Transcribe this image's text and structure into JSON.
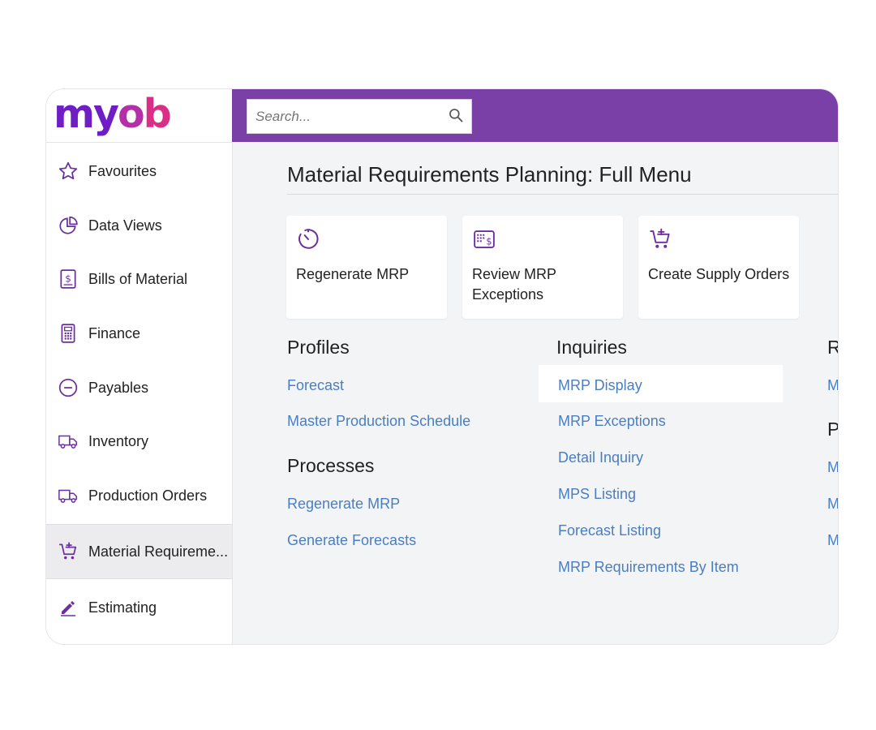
{
  "brand": {
    "logo_text_1": "my",
    "logo_text_2": "o",
    "logo_text_3": "b",
    "colors": {
      "purple": "#6e1ec4",
      "magenta": "#b52fa8",
      "pink": "#d92f86",
      "topbar": "#7b3fa8",
      "link": "#4a7ec2"
    }
  },
  "search": {
    "placeholder": "Search...",
    "icon": "search-icon"
  },
  "sidebar": {
    "items": [
      {
        "label": "Favourites",
        "icon": "star-icon"
      },
      {
        "label": "Data Views",
        "icon": "pie-chart-icon"
      },
      {
        "label": "Bills of Material",
        "icon": "dollar-document-icon"
      },
      {
        "label": "Finance",
        "icon": "calculator-icon"
      },
      {
        "label": "Payables",
        "icon": "minus-circle-icon"
      },
      {
        "label": "Inventory",
        "icon": "truck-icon"
      },
      {
        "label": "Production Orders",
        "icon": "truck-icon"
      },
      {
        "label": "Material Requireme...",
        "icon": "cart-plus-icon",
        "active": true
      },
      {
        "label": "Estimating",
        "icon": "pencil-icon"
      }
    ]
  },
  "main": {
    "title": "Material Requirements Planning: Full Menu",
    "tiles": [
      {
        "label": "Regenerate MRP",
        "icon": "timer-icon"
      },
      {
        "label": "Review MRP Exceptions",
        "icon": "calculator-dollar-icon"
      },
      {
        "label": "Create Supply Orders",
        "icon": "cart-plus-icon"
      }
    ],
    "profiles": {
      "title": "Profiles",
      "links": [
        "Forecast",
        "Master Production Schedule"
      ]
    },
    "processes": {
      "title": "Processes",
      "links": [
        "Regenerate MRP",
        "Generate Forecasts"
      ]
    },
    "inquiries": {
      "title": "Inquiries",
      "links": [
        "MRP Display",
        "MRP Exceptions",
        "Detail Inquiry",
        "MPS Listing",
        "Forecast Listing",
        "MRP Requirements By Item"
      ]
    },
    "cut_column": {
      "heading_1": "R",
      "link_1": "M",
      "heading_2": "P",
      "link_2": "M",
      "link_3": "M",
      "link_4": "M"
    }
  }
}
